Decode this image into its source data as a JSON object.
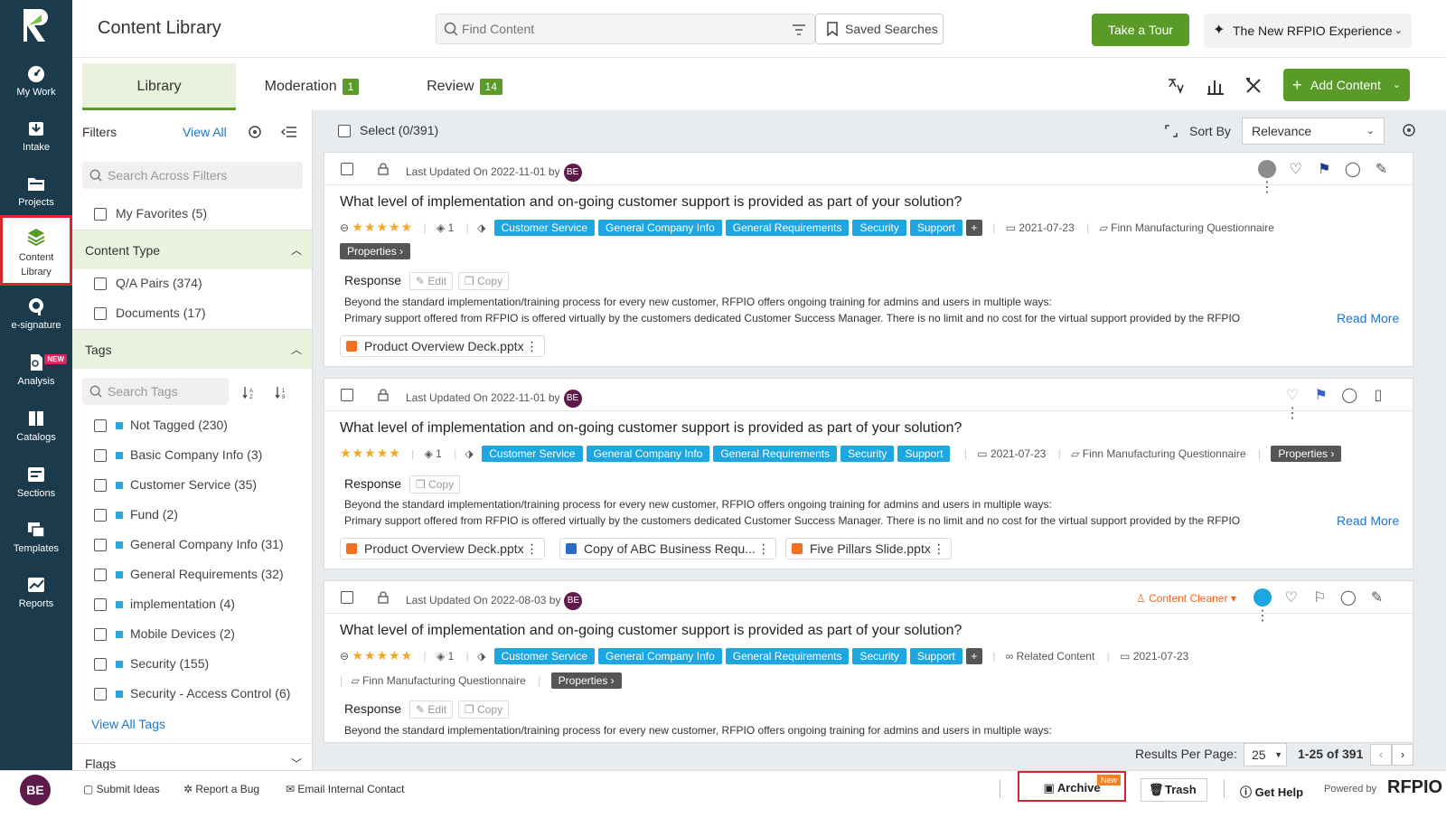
{
  "nav": {
    "items": [
      {
        "label": "My Work",
        "icon": "gauge-icon"
      },
      {
        "label": "Intake",
        "icon": "inbox-download-icon"
      },
      {
        "label": "Projects",
        "icon": "folder-icon"
      },
      {
        "label": "Content Library",
        "icon": "layers-icon"
      },
      {
        "label": "e-signature",
        "icon": "signature-icon"
      },
      {
        "label": "Analysis",
        "icon": "document-search-icon",
        "badge": "NEW"
      },
      {
        "label": "Catalogs",
        "icon": "book-icon"
      },
      {
        "label": "Sections",
        "icon": "sections-icon"
      },
      {
        "label": "Templates",
        "icon": "templates-icon"
      },
      {
        "label": "Reports",
        "icon": "chart-line-icon"
      }
    ]
  },
  "header": {
    "title": "Content Library",
    "search_placeholder": "Find Content",
    "saved_searches": "Saved Searches",
    "tour": "Take a Tour",
    "experience": "The New RFPIO Experience"
  },
  "tabs": [
    {
      "label": "Library",
      "count": ""
    },
    {
      "label": "Moderation",
      "count": "1"
    },
    {
      "label": "Review",
      "count": "14"
    }
  ],
  "add_content": "Add Content",
  "filters": {
    "title": "Filters",
    "view_all": "View All",
    "search_placeholder": "Search Across Filters",
    "favorites": "My Favorites (5)",
    "content_type_title": "Content Type",
    "content_types": [
      "Q/A Pairs (374)",
      "Documents (17)"
    ],
    "tags_title": "Tags",
    "tags_placeholder": "Search Tags",
    "tags": [
      "Not Tagged (230)",
      "Basic Company Info (3)",
      "Customer Service (35)",
      "Fund (2)",
      "General Company Info (31)",
      "General Requirements (32)",
      "implementation (4)",
      "Mobile Devices (2)",
      "Security (155)",
      "Security - Access Control (6)"
    ],
    "view_all_tags": "View All Tags",
    "flags_title": "Flags"
  },
  "list": {
    "select_label": "Select (0/391)",
    "sort_label": "Sort By",
    "sort_value": "Relevance",
    "results_per_page_label": "Results Per Page:",
    "results_per_page": "25",
    "range": "1-25 of 391"
  },
  "cards": [
    {
      "updated": "Last Updated On 2022-11-01 by",
      "user": "BE",
      "question": "What level of implementation and on-going customer support is provided as part of your solution?",
      "stars": "★★★★★",
      "versions": "1",
      "tags": [
        "Customer Service",
        "General Company Info",
        "General Requirements",
        "Security",
        "Support"
      ],
      "date": "2021-07-23",
      "project": "Finn Manufacturing Questionnaire",
      "properties": "Properties",
      "response_label": "Response",
      "edit": "Edit",
      "copy": "Copy",
      "line1": "Beyond the standard implementation/training process for every new customer, RFPIO offers ongoing training for admins and users in multiple ways:",
      "line2": "Primary support offered from RFPIO is offered virtually by the customers dedicated Customer Success Manager. There is no limit and no cost for the virtual support provided by the RFPIO",
      "read_more": "Read More",
      "attachments": [
        "Product Overview Deck.pptx"
      ]
    },
    {
      "updated": "Last Updated On 2022-11-01 by",
      "user": "BE",
      "question": "What level of implementation and on-going customer support is provided as part of your solution?",
      "stars": "★★★★★",
      "versions": "1",
      "tags": [
        "Customer Service",
        "General Company Info",
        "General Requirements",
        "Security",
        "Support"
      ],
      "date": "2021-07-23",
      "project": "Finn Manufacturing Questionnaire",
      "properties": "Properties",
      "response_label": "Response",
      "copy": "Copy",
      "line1": "Beyond the standard implementation/training process for every new customer, RFPIO offers ongoing training for admins and users in multiple ways:",
      "line2": "Primary support offered from RFPIO is offered virtually by the customers dedicated Customer Success Manager. There is no limit and no cost for the virtual support provided by the RFPIO",
      "read_more": "Read More",
      "attachments": [
        "Product Overview Deck.pptx",
        "Copy of ABC Business Requ...",
        "Five Pillars Slide.pptx"
      ]
    },
    {
      "updated": "Last Updated On 2022-08-03 by",
      "user": "BE",
      "question": "What level of implementation and on-going customer support is provided as part of your solution?",
      "stars": "★★★★★",
      "versions": "1",
      "tags": [
        "Customer Service",
        "General Company Info",
        "General Requirements",
        "Security",
        "Support"
      ],
      "related": "Related Content",
      "date": "2021-07-23",
      "project": "Finn Manufacturing Questionnaire",
      "properties": "Properties",
      "cleaner": "Content Cleaner",
      "response_label": "Response",
      "edit": "Edit",
      "copy": "Copy",
      "line1": "Beyond the standard implementation/training process for every new customer, RFPIO offers ongoing training for admins and users in multiple ways:"
    }
  ],
  "footer": {
    "user": "BE",
    "submit_ideas": "Submit Ideas",
    "report_bug": "Report a Bug",
    "email_contact": "Email Internal Contact",
    "archive": "Archive",
    "archive_badge": "New",
    "trash": "Trash",
    "help": "Get Help",
    "powered": "Powered by",
    "brand": "RFPIO"
  },
  "colors": {
    "nav_bg": "#1b3a4b",
    "accent_green": "#5a9a28",
    "tag_blue": "#1ea6e0",
    "link_blue": "#1976d2",
    "highlight_red": "#d9272e"
  }
}
